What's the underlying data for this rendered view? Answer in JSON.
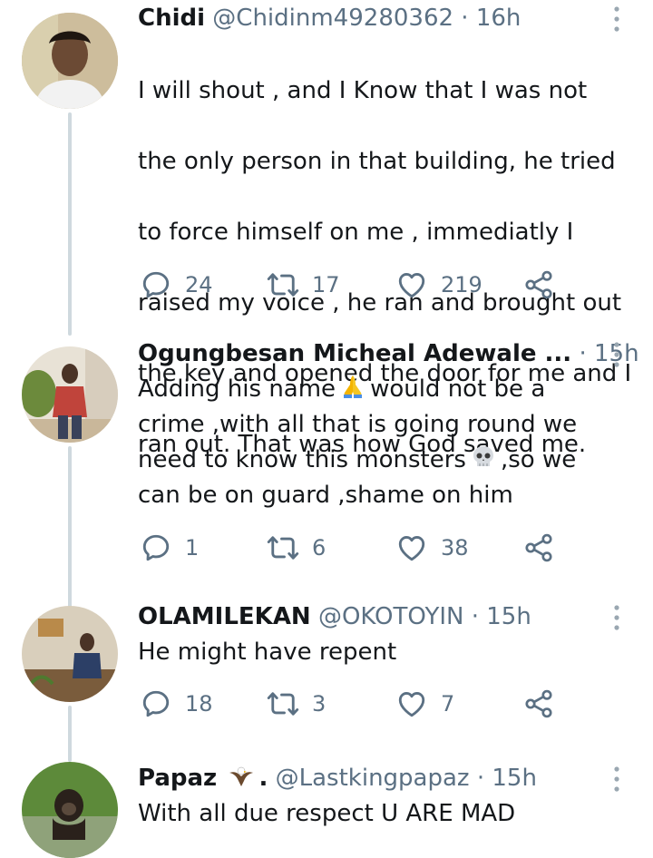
{
  "tweets": [
    {
      "name": "Chidi",
      "handle": "@Chidinm49280362",
      "separator": "·",
      "time": "16h",
      "text_lines": [
        "I will shout , and I Know that I was not",
        "the only person in that building, he tried",
        "to force himself on me , immediatly I",
        "raised my voice , he ran and brought out",
        "the key and opened the door for me and I",
        "ran out. That was how God saved me."
      ],
      "replies": "24",
      "retweets": "17",
      "likes": "219"
    },
    {
      "name": "Ogungbesan Micheal Adewale ...",
      "handle": "",
      "separator": "·",
      "time": "15h",
      "text_parts": {
        "a": "Adding his name",
        "a_emoji": "folded-hands-emoji",
        "b": "would not be a",
        "line2": "crime ,with all that is going round we",
        "c": "need to know this monsters",
        "c_emoji": "skull-emoji",
        "d": ",so we",
        "line4": "can be on guard ,shame on him"
      },
      "replies": "1",
      "retweets": "6",
      "likes": "38"
    },
    {
      "name": "OLAMILEKAN",
      "handle": "@OKOTOYIN",
      "separator": "·",
      "time": "15h",
      "text": "He might have repent",
      "replies": "18",
      "retweets": "3",
      "likes": "7"
    },
    {
      "name": "Papaz",
      "name_emoji": "eagle-emoji",
      "name_suffix": ".",
      "handle": "@Lastkingpapaz",
      "separator": "·",
      "time": "15h",
      "text": "With all due respect U ARE MAD"
    }
  ],
  "icons": {
    "reply": "reply-icon",
    "retweet": "retweet-icon",
    "like": "heart-icon",
    "share": "share-icon",
    "more": "more-vertical-icon"
  },
  "colors": {
    "text": "#14171a",
    "secondary": "#5b7083",
    "thread_line": "#cfd9de"
  }
}
